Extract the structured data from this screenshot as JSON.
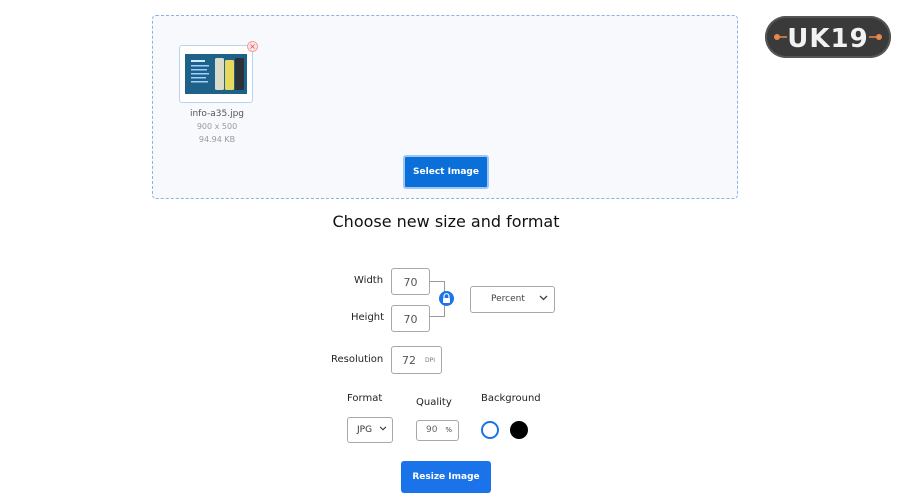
{
  "logo": {
    "text": "UK19"
  },
  "file": {
    "name": "info-a35.jpg",
    "dimensions": "900 x 500",
    "size": "94.94 KB"
  },
  "upload": {
    "select_label": "Select Image"
  },
  "section_title": "Choose new size and format",
  "resize": {
    "width_label": "Width",
    "width_value": "70",
    "height_label": "Height",
    "height_value": "70",
    "unit_selected": "Percent",
    "resolution_label": "Resolution",
    "resolution_value": "72",
    "resolution_unit": "DPI"
  },
  "output": {
    "format_label": "Format",
    "format_selected": "JPG",
    "quality_label": "Quality",
    "quality_value": "90",
    "quality_unit": "%",
    "background_label": "Background",
    "background_options": [
      "#ffffff",
      "#000000"
    ]
  },
  "action": {
    "resize_label": "Resize Image"
  },
  "colors": {
    "accent": "#1a73e8",
    "dropzone_border": "#8ab4e8",
    "logo_bg": "#3a3a3a",
    "logo_accent": "#e8894a"
  }
}
